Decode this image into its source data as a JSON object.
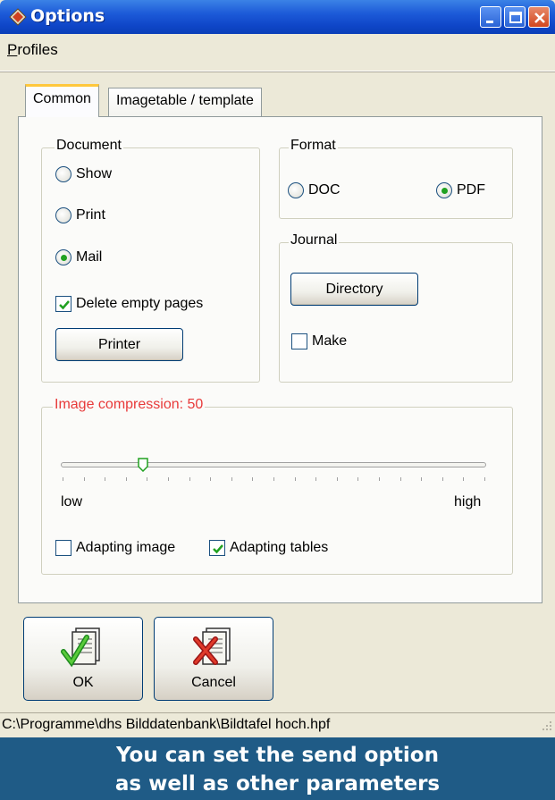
{
  "window": {
    "title": "Options",
    "icon": "app-diamond-icon",
    "controls": [
      "minimize-icon",
      "maximize-icon",
      "close-icon"
    ]
  },
  "menu": {
    "items": [
      "Profiles"
    ]
  },
  "tabs": [
    {
      "label": "Common",
      "active": true
    },
    {
      "label": "Imagetable / template",
      "active": false
    }
  ],
  "document_group": {
    "label": "Document",
    "options": [
      {
        "label": "Show",
        "selected": false
      },
      {
        "label": "Print",
        "selected": false
      },
      {
        "label": "Mail",
        "selected": true
      }
    ],
    "delete_empty_pages": {
      "label": "Delete empty pages",
      "checked": true
    },
    "printer_button": "Printer"
  },
  "format_group": {
    "label": "Format",
    "options": [
      {
        "label": "DOC",
        "selected": false
      },
      {
        "label": "PDF",
        "selected": true
      }
    ]
  },
  "journal_group": {
    "label": "Journal",
    "directory_button": "Directory",
    "make": {
      "label": "Make",
      "checked": false
    }
  },
  "compression_group": {
    "label": "Image compression: 50",
    "label_color": "#E83A3A",
    "slider": {
      "value": 50,
      "low_label": "low",
      "high_label": "high"
    },
    "adapting_image": {
      "label": "Adapting image",
      "checked": false
    },
    "adapting_tables": {
      "label": "Adapting tables",
      "checked": true
    }
  },
  "buttons": {
    "ok": {
      "label": "OK",
      "icon": "document-check-icon"
    },
    "cancel": {
      "label": "Cancel",
      "icon": "document-cross-icon"
    }
  },
  "statusbar": {
    "path": "C:\\Programme\\dhs Bilddatenbank\\Bildtafel hoch.hpf"
  },
  "caption": {
    "line1": "You can set the send option",
    "line2": "as well as other parameters",
    "background": "#1F5B86"
  }
}
